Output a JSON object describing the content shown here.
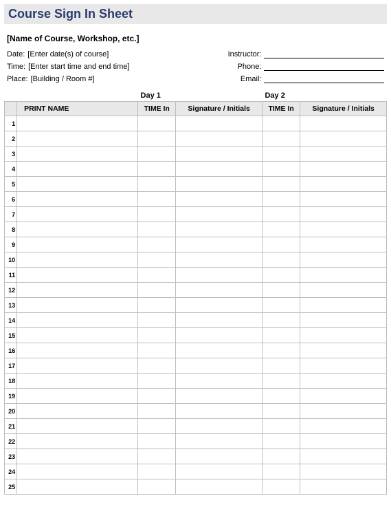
{
  "title": "Course Sign In Sheet",
  "course_name_placeholder": "[Name of Course, Workshop, etc.]",
  "left_meta": {
    "date": {
      "label": "Date:",
      "value": "[Enter date(s) of course]"
    },
    "time": {
      "label": "Time:",
      "value": "[Enter start time and end time]"
    },
    "place": {
      "label": "Place:",
      "value": "[Building / Room #]"
    }
  },
  "right_meta": {
    "instructor": {
      "label": "Instructor:"
    },
    "phone": {
      "label": "Phone:"
    },
    "email": {
      "label": "Email:"
    }
  },
  "days": {
    "day1": "Day 1",
    "day2": "Day 2"
  },
  "columns": {
    "print_name": "PRINT NAME",
    "time_in": "TIME In",
    "signature": "Signature / Initials"
  },
  "row_count": 25
}
